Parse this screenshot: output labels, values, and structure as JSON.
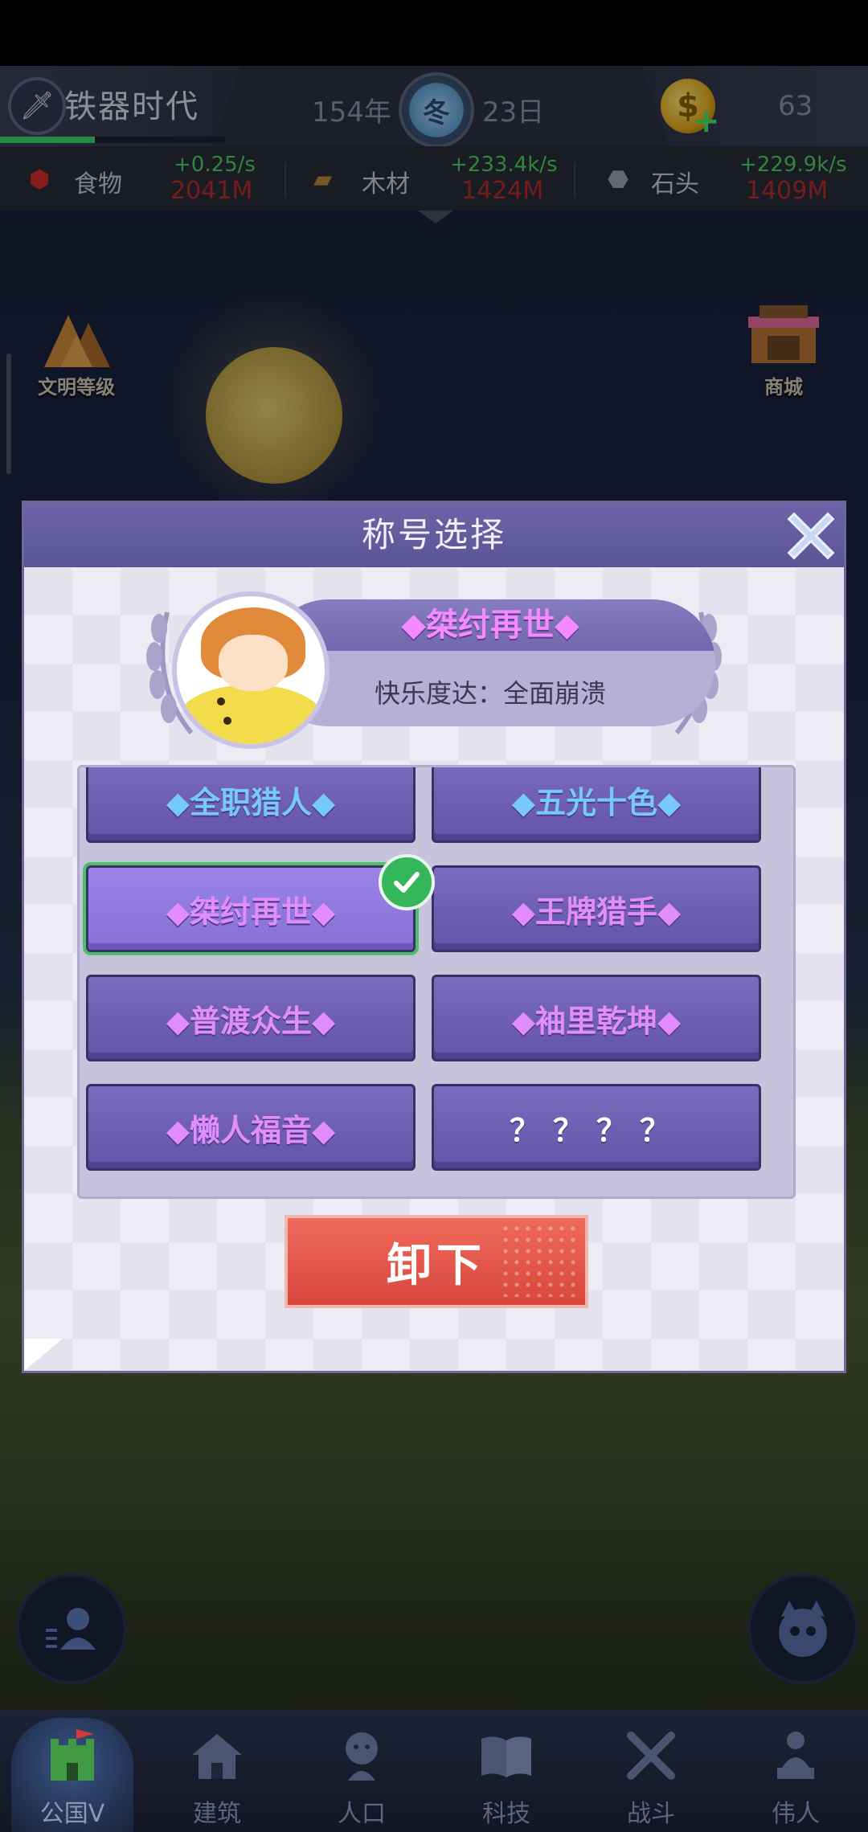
{
  "hud": {
    "age_title": "铁器时代",
    "year": "154年",
    "season": "冬",
    "day": "23日",
    "coins": "63",
    "age_progress": 0.42
  },
  "resources": [
    {
      "name": "食物",
      "rate": "+0.25/s",
      "amount": "2041M",
      "icon": "meat-icon"
    },
    {
      "name": "木材",
      "rate": "+233.4k/s",
      "amount": "1424M",
      "icon": "wood-icon"
    },
    {
      "name": "石头",
      "rate": "+229.9k/s",
      "amount": "1409M",
      "icon": "stone-icon"
    }
  ],
  "side": {
    "civ_label": "文明等级",
    "shop_label": "商城"
  },
  "dialog": {
    "title": "称号选择",
    "current_title": "◆桀纣再世◆",
    "happiness": "快乐度达：全面崩溃",
    "titles": [
      {
        "label": "◆全职猎人◆",
        "color": "blue"
      },
      {
        "label": "◆五光十色◆",
        "color": "blue"
      },
      {
        "label": "◆桀纣再世◆",
        "color": "pink",
        "selected": true
      },
      {
        "label": "◆王牌猎手◆",
        "color": "pink"
      },
      {
        "label": "◆普渡众生◆",
        "color": "pink"
      },
      {
        "label": "◆袖里乾坤◆",
        "color": "pink"
      },
      {
        "label": "◆懒人福音◆",
        "color": "pink"
      },
      {
        "label": "？？？？",
        "color": "white"
      }
    ],
    "unequip_label": "卸下"
  },
  "nav": [
    {
      "label": "公国V",
      "icon": "castle-icon",
      "active": true
    },
    {
      "label": "建筑",
      "icon": "house-icon"
    },
    {
      "label": "人口",
      "icon": "person-icon"
    },
    {
      "label": "科技",
      "icon": "book-icon"
    },
    {
      "label": "战斗",
      "icon": "swords-icon"
    },
    {
      "label": "伟人",
      "icon": "statue-icon"
    }
  ],
  "colors": {
    "dialog_header": "#6c64a6",
    "title_pink": "#e18cff",
    "title_blue": "#76c8ff",
    "selected_border": "#47c266",
    "unequip": "#e0524a"
  }
}
